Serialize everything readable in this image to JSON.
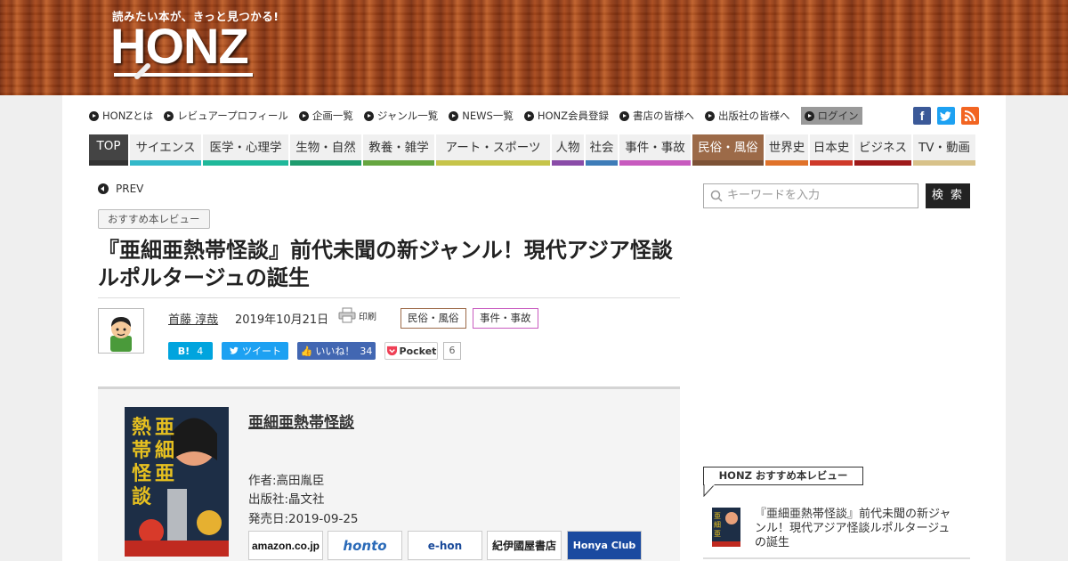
{
  "header": {
    "tagline": "読みたい本が、きっと見つかる!",
    "logo": "HONZ"
  },
  "topnav": {
    "items": [
      "HONZとは",
      "レビュアープロフィール",
      "企画一覧",
      "ジャンル一覧",
      "NEWS一覧",
      "HONZ会員登録",
      "書店の皆様へ",
      "出版社の皆様へ"
    ],
    "login": "ログイン"
  },
  "social": {
    "facebook": "f",
    "twitter": "t",
    "rss": "rss",
    "facebook_color": "#3b5998",
    "twitter_color": "#1da1f2",
    "rss_color": "#f26522"
  },
  "categories": [
    {
      "label": "TOP",
      "color": "#555555"
    },
    {
      "label": "サイエンス",
      "color": "#33b8c9"
    },
    {
      "label": "医学・心理学",
      "color": "#1fb89a"
    },
    {
      "label": "生物・自然",
      "color": "#1e9c6e"
    },
    {
      "label": "教養・雑学",
      "color": "#66a640"
    },
    {
      "label": "アート・スポーツ",
      "color": "#c6c44a"
    },
    {
      "label": "人物",
      "color": "#8a4ca8"
    },
    {
      "label": "社会",
      "color": "#3e7cb8"
    },
    {
      "label": "事件・事故",
      "color": "#c85bbf"
    },
    {
      "label": "民俗・風俗",
      "color": "#9c6a48"
    },
    {
      "label": "世界史",
      "color": "#e0722a"
    },
    {
      "label": "日本史",
      "color": "#cf3a2a"
    },
    {
      "label": "ビジネス",
      "color": "#9e1a1a"
    },
    {
      "label": "TV・動画",
      "color": "#d8c28a"
    }
  ],
  "article": {
    "prev": "PREV",
    "badge": "おすすめ本レビュー",
    "title": "『亜細亜熱帯怪談』前代未聞の新ジャンル！現代アジア怪談ルポルタージュの誕生",
    "author": "首藤 淳哉",
    "date": "2019年10月21日",
    "print": "印刷",
    "tags": [
      "民俗・風俗",
      "事件・事故"
    ],
    "share": {
      "hatena_label": "B!",
      "hatena_count": "4",
      "tweet": "ツイート",
      "like": "いいね！",
      "like_count": "34",
      "pocket": "Pocket",
      "pocket_count": "6"
    }
  },
  "book": {
    "title": "亜細亜熱帯怪談",
    "author": "作者:高田胤臣",
    "publisher": "出版社:晶文社",
    "release": "発売日:2019-09-25",
    "cover_title": "亜細亜熱帯怪談",
    "shops": [
      "amazon.co.jp",
      "honto",
      "e-hon",
      "紀伊國屋書店",
      "Honya Club"
    ]
  },
  "sidebar": {
    "search_placeholder": "キーワードを入力",
    "search_button": "検 索",
    "rec_label": "HONZ おすすめ本レビュー",
    "rec_title": "『亜細亜熱帯怪談』前代未聞の新ジャンル！現代アジア怪談ルポルタージュの誕生"
  }
}
